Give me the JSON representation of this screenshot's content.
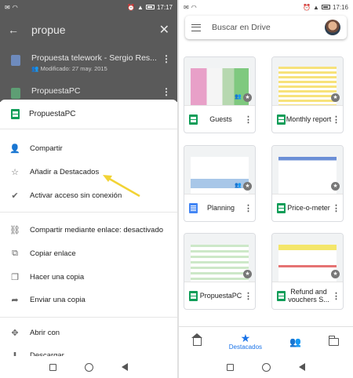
{
  "left": {
    "status": {
      "time": "17:17",
      "battery": ""
    },
    "search": {
      "query": "propue"
    },
    "results": [
      {
        "title": "Propuesta telework - Sergio Res...",
        "subtitle": "Modificado: 27 may. 2015"
      },
      {
        "title": "PropuestaPC",
        "subtitle": ""
      }
    ],
    "sheet": {
      "title": "PropuestaPC",
      "items": [
        {
          "label": "Compartir",
          "icon": "person-add-icon",
          "glyph": "👤"
        },
        {
          "label": "Añadir a Destacados",
          "icon": "star-icon",
          "glyph": "☆"
        },
        {
          "label": "Activar acceso sin conexión",
          "icon": "offline-icon",
          "glyph": "✔"
        },
        {
          "label": "Compartir mediante enlace: desactivado",
          "icon": "link-off-icon",
          "glyph": "⛓"
        },
        {
          "label": "Copiar enlace",
          "icon": "copy-icon",
          "glyph": "⧉"
        },
        {
          "label": "Hacer una copia",
          "icon": "file-copy-icon",
          "glyph": "❐"
        },
        {
          "label": "Enviar una copia",
          "icon": "send-icon",
          "glyph": "➦"
        },
        {
          "label": "Abrir con",
          "icon": "open-with-icon",
          "glyph": "✥"
        },
        {
          "label": "Descargar",
          "icon": "download-icon",
          "glyph": "⬇"
        }
      ]
    },
    "annotation_color": "#f2d335"
  },
  "right": {
    "status": {
      "time": "17:16"
    },
    "search": {
      "placeholder": "Buscar en Drive"
    },
    "files": [
      {
        "name": "Guests",
        "type": "sheet",
        "shared": true
      },
      {
        "name": "Monthly report",
        "type": "sheet",
        "shared": false
      },
      {
        "name": "Planning",
        "type": "doc",
        "shared": true
      },
      {
        "name": "Price-o-meter",
        "type": "sheet",
        "shared": false
      },
      {
        "name": "PropuestaPC",
        "type": "sheet",
        "shared": false
      },
      {
        "name": "Refund and vouchers S...",
        "type": "sheet",
        "shared": false
      }
    ],
    "bottom_nav": [
      {
        "label": "",
        "icon": "home-icon"
      },
      {
        "label": "Destacados",
        "icon": "star-icon",
        "active": true
      },
      {
        "label": "",
        "icon": "shared-icon"
      },
      {
        "label": "",
        "icon": "folder-icon"
      }
    ],
    "accent": "#1a73e8"
  }
}
